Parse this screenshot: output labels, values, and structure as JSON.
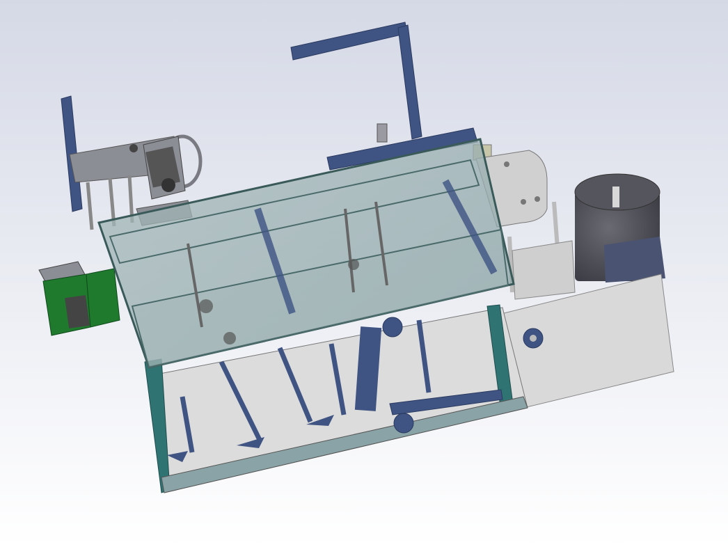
{
  "viewport": {
    "background_top": "#d5d9e6",
    "background_bottom": "#ffffff"
  },
  "colors": {
    "frame_blue": "#3f5483",
    "frame_blue_dark": "#2a3a60",
    "steel_grey": "#8c8e96",
    "light_panel": "#d9d9d9",
    "glass": "#9fb3b3",
    "teal_side": "#2f7373",
    "pcb_green": "#1f7a2e",
    "motor_dark": "#4a4a52"
  },
  "components": [
    "upper-gantry-frame",
    "left-pulley-bracket",
    "motor-unit",
    "transparent-cover",
    "machine-base-frame",
    "control-box",
    "drum-motor",
    "side-panel",
    "circuit-board",
    "adjustment-knobs"
  ]
}
